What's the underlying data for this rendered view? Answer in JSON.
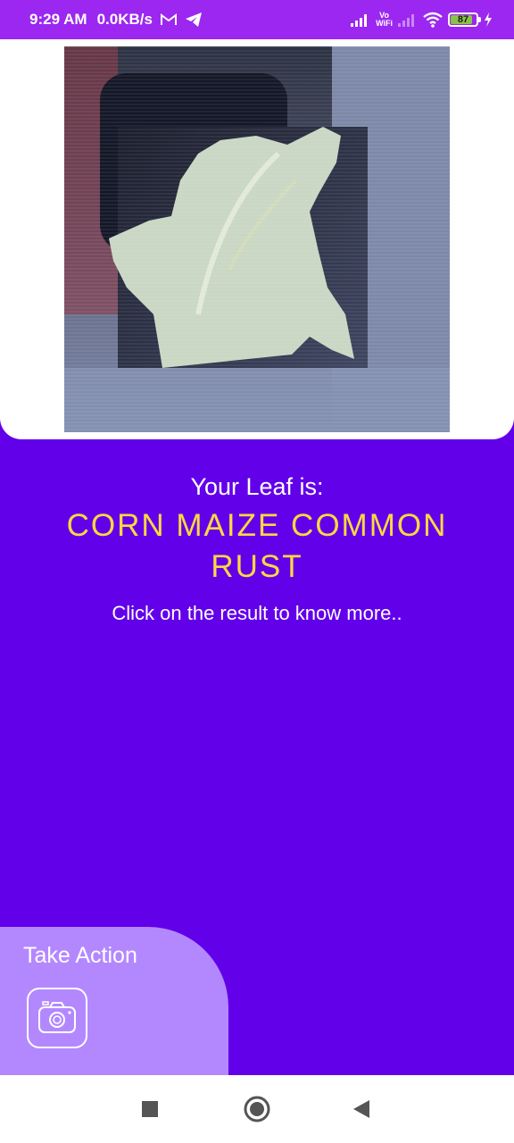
{
  "status_bar": {
    "time": "9:29 AM",
    "net_speed": "0.0KB/s",
    "vowifi_top": "Vo",
    "vowifi_bottom": "WiFi",
    "battery_level": "87",
    "battery_fraction": 0.87,
    "icons": [
      "gmail-icon",
      "telegram-icon",
      "signal-icon",
      "vowifi-icon",
      "signal-weak-icon",
      "wifi-icon",
      "battery-icon",
      "charging-icon"
    ]
  },
  "result": {
    "heading": "Your Leaf is:",
    "value": "CORN MAIZE COMMON RUST",
    "hint": "Click on the result to know more.."
  },
  "action": {
    "title": "Take Action",
    "icon": "camera-icon"
  },
  "nav": {
    "icons": [
      "recents-icon",
      "home-icon",
      "back-icon"
    ]
  },
  "colors": {
    "status_bar": "#9C27F0",
    "background": "#6200EA",
    "result_value": "#FFD740",
    "action_panel": "#B388FF"
  }
}
